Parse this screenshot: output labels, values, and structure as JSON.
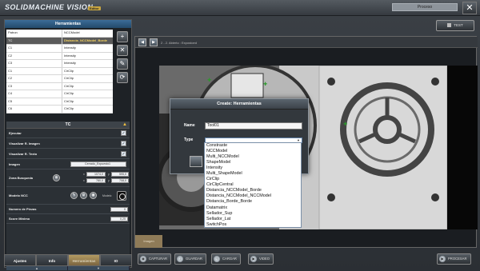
{
  "header": {
    "logo": "SOLIDMACHINE VISION",
    "badge": "Editor",
    "proceso": "Proceso",
    "close": "✕"
  },
  "left_panel": {
    "title": "Herramientas",
    "tools": [
      {
        "name": "Patron",
        "type": "NCCModel"
      },
      {
        "name": "TC",
        "type": "Distancia_NCCModel_Borde",
        "selected": true
      },
      {
        "name": "C1",
        "type": "Intensity"
      },
      {
        "name": "C2",
        "type": "Intensity"
      },
      {
        "name": "C3",
        "type": "Intensity"
      },
      {
        "name": "C1",
        "type": "CirClip"
      },
      {
        "name": "C2",
        "type": "CirClip"
      },
      {
        "name": "C3",
        "type": "CirClip"
      },
      {
        "name": "C4",
        "type": "CirClip"
      },
      {
        "name": "C5",
        "type": "CirClip"
      },
      {
        "name": "C6",
        "type": "CirClip"
      }
    ],
    "tool_buttons": [
      "+",
      "✕",
      "✎",
      "⟳"
    ],
    "tc": {
      "title": "TC",
      "ejecutar": "Ejecutar",
      "visualizar_imagen": "Visualizar R. Imagen",
      "visualizar_texto": "Visualizar R. Texto",
      "imagen_label": "Imagen",
      "imagen_value": "Cerrado_Expuesto1",
      "zona_label": "Zona Busqueda",
      "zona_vals": [
        "1074,0",
        "595,0",
        "780,0",
        "708,0"
      ],
      "zona_prefix": [
        "x",
        "y",
        "x",
        "y"
      ],
      "modelo_label": "Modelo NCC",
      "modelo_text": "Modelo",
      "numero_label": "Numero de Piezas",
      "numero_value": "0",
      "score_label": "Score Minimo",
      "score_value": "0,25"
    },
    "scroll": [
      "▲",
      "▼"
    ]
  },
  "left_tabs": [
    "Ajustes",
    "Info",
    "Herramientas",
    "IO"
  ],
  "test_label": "TEST",
  "viewer": {
    "title": "2 - 2. Abierto : Expostoed",
    "imagen_btn": "Imagen"
  },
  "bottom_buttons": [
    {
      "label": "CAPTURAR",
      "icon": "camera-icon",
      "glyph": "◉"
    },
    {
      "label": "GUARDAR",
      "icon": "save-icon",
      "glyph": "↓"
    },
    {
      "label": "CARGAR",
      "icon": "load-icon",
      "glyph": "↑"
    },
    {
      "label": "VIDEO",
      "icon": "video-icon",
      "glyph": "▶"
    },
    {
      "label": "PROCESAR",
      "icon": "process-icon",
      "glyph": "▶"
    }
  ],
  "dialog": {
    "title": "Create: Herramientas",
    "name_label": "Name",
    "name_value": "Tool01",
    "type_label": "Type",
    "type_options": [
      "Constraste",
      "NCCModel",
      "Multi_NCCModel",
      "ShapeModel",
      "Intensity",
      "Multi_ShapeModel",
      "CirClip",
      "CirClipCentral",
      "Distancia_NCCModel_Borde",
      "Distancia_NCCModel_NCCModel",
      "Distancia_Borde_Borde",
      "Datamatrix",
      "Sellador_Sup",
      "Sellador_Lat",
      "SwitchPos"
    ]
  }
}
